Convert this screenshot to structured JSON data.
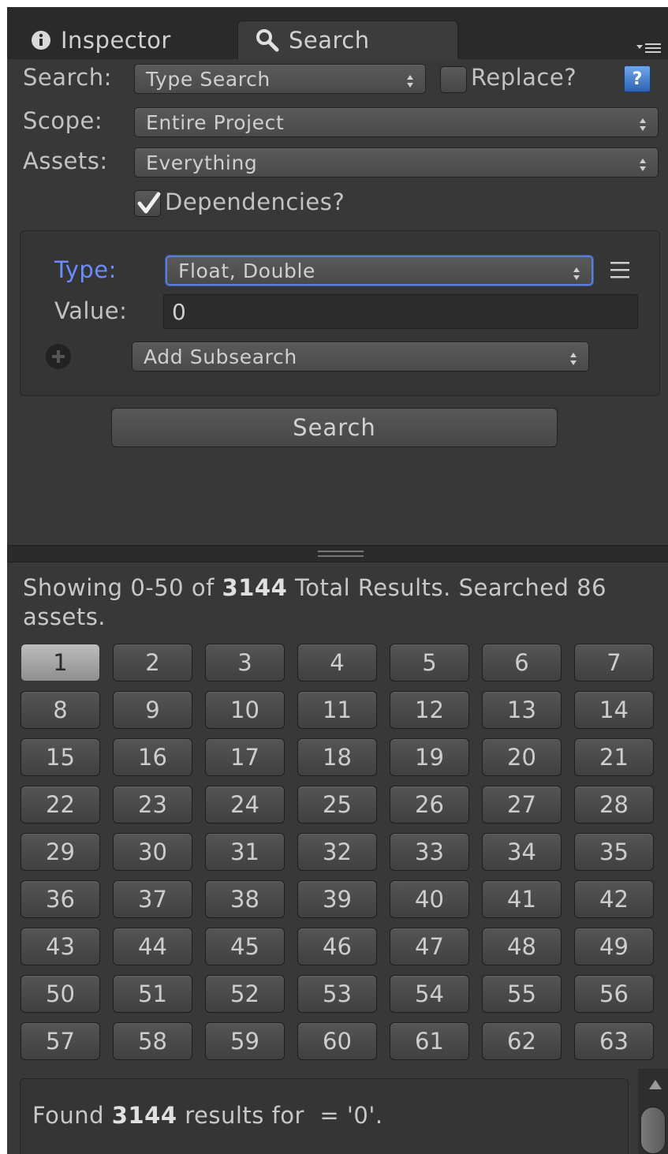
{
  "tabs": {
    "inspector": {
      "icon": "info-icon",
      "label": "Inspector"
    },
    "search": {
      "icon": "magnifier-icon",
      "label": "Search"
    },
    "menu_icon": "tab-menu-icon"
  },
  "form": {
    "search_label": "Search:",
    "search_value": "Type Search",
    "replace_label": "Replace?",
    "replace_checked": false,
    "help_icon": "help-icon",
    "scope_label": "Scope:",
    "scope_value": "Entire Project",
    "assets_label": "Assets:",
    "assets_value": "Everything",
    "dependencies_label": "Dependencies?",
    "dependencies_checked": true
  },
  "subsearch": {
    "type_label": "Type:",
    "type_value": "Float, Double",
    "value_label": "Value:",
    "value": "0",
    "add_icon": "plus-circle-icon",
    "add_subsearch": "Add Subsearch",
    "menu_icon": "hamburger-icon"
  },
  "search_button": "Search",
  "results": {
    "showing_prefix": "Showing 0-50 of ",
    "total": "3144",
    "showing_suffix": " Total Results. Searched 86 assets.",
    "pages": [
      "1",
      "2",
      "3",
      "4",
      "5",
      "6",
      "7",
      "8",
      "9",
      "10",
      "11",
      "12",
      "13",
      "14",
      "15",
      "16",
      "17",
      "18",
      "19",
      "20",
      "21",
      "22",
      "23",
      "24",
      "25",
      "26",
      "27",
      "28",
      "29",
      "30",
      "31",
      "32",
      "33",
      "34",
      "35",
      "36",
      "37",
      "38",
      "39",
      "40",
      "41",
      "42",
      "43",
      "44",
      "45",
      "46",
      "47",
      "48",
      "49",
      "50",
      "51",
      "52",
      "53",
      "54",
      "55",
      "56",
      "57",
      "58",
      "59",
      "60",
      "61",
      "62",
      "63"
    ],
    "active_page": "1"
  },
  "status": {
    "prefix": "Found ",
    "count": "3144",
    "suffix": " results for  = '0'."
  },
  "colors": {
    "accent_blue": "#6a8cff",
    "background": "#383838"
  }
}
